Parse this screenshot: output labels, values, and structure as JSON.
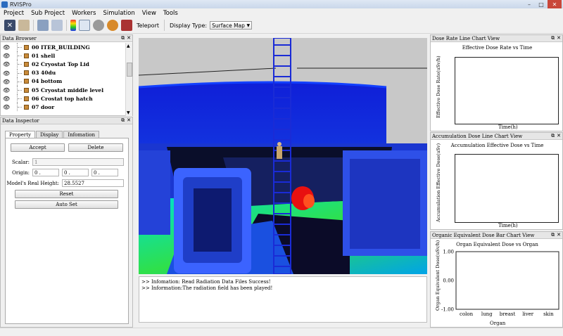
{
  "window": {
    "title": "RVISPro",
    "min": "–",
    "max": "□",
    "close": "✕"
  },
  "menu": [
    "Project",
    "Sub Project",
    "Workers",
    "Simulation",
    "View",
    "Tools"
  ],
  "toolbar": {
    "teleport_label": "Teleport",
    "display_type_label": "Display Type:",
    "display_type_value": "Surface Map"
  },
  "data_browser": {
    "title": "Data Browser",
    "items": [
      {
        "label": "00 ITER_BUILDING"
      },
      {
        "label": "01 shell"
      },
      {
        "label": "02 Cryostat Top Lid"
      },
      {
        "label": "03 40du"
      },
      {
        "label": "04 bottom"
      },
      {
        "label": "05 Cryostat middle level"
      },
      {
        "label": "06 Crostat top hatch"
      },
      {
        "label": "07 door"
      }
    ]
  },
  "data_inspector": {
    "title": "Data Inspector",
    "tabs": [
      "Property",
      "Display",
      "Infomation"
    ],
    "accept_label": "Accept",
    "delete_label": "Delete",
    "scalar_label": "Scalar:",
    "scalar_value": "1",
    "origin_label": "Origin:",
    "origin_x": "0 .",
    "origin_y": "0 .",
    "origin_z": "0 .",
    "real_height_label": "Model's Real Height:",
    "real_height_value": "28.5527",
    "reset_label": "Reset",
    "autoset_label": "Auto Set"
  },
  "output": {
    "lines": [
      ">> Infomation: Read Radiation Data Files Success!",
      ">> Information:The radiation field has been played!"
    ]
  },
  "charts": {
    "dose_rate": {
      "panel_title": "Dose Rate Line Chart View",
      "title": "Effective Dose Rate vs Time",
      "ylabel": "Effective Dose Rate(uSv/h)",
      "xlabel": "Time(h)"
    },
    "accumulation": {
      "panel_title": "Accumulation Dose Line Chart View",
      "title": "Accumulation Effective Dose vs Time",
      "ylabel": "Accumulation Effective Dose(uSv)",
      "xlabel": "Time(h)"
    },
    "organic": {
      "panel_title": "Organic Equivalent Dose Bar Chart View",
      "title": "Organ Equivalent Dose vs Organ",
      "ylabel": "Organ Equivalent Dose(uSv/h)",
      "xlabel": "Organ"
    }
  },
  "chart_data": [
    {
      "type": "line",
      "title": "Effective Dose Rate vs Time",
      "xlabel": "Time(h)",
      "ylabel": "Effective Dose Rate(uSv/h)",
      "series": []
    },
    {
      "type": "line",
      "title": "Accumulation Effective Dose vs Time",
      "xlabel": "Time(h)",
      "ylabel": "Accumulation Effective Dose(uSv)",
      "series": []
    },
    {
      "type": "bar",
      "title": "Organ Equivalent Dose vs Organ",
      "xlabel": "Organ",
      "ylabel": "Organ Equivalent Dose(uSv/h)",
      "categories": [
        "colon",
        "lung",
        "breast",
        "liver",
        "skin"
      ],
      "values": [
        0,
        0,
        0,
        0,
        0
      ],
      "yticks": [
        "1.00",
        "0.00",
        "-1.00"
      ],
      "ylim": [
        -1,
        1
      ]
    }
  ]
}
